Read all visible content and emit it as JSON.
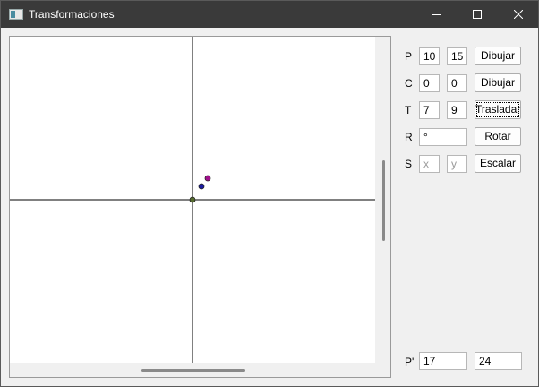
{
  "window": {
    "title": "Transformaciones"
  },
  "rows": [
    {
      "label": "P",
      "a": "10",
      "b": "15",
      "button": "Dibujar"
    },
    {
      "label": "C",
      "a": "0",
      "b": "0",
      "button": "Dibujar"
    },
    {
      "label": "T",
      "a": "7",
      "b": "9",
      "button": "Trasladar"
    },
    {
      "label": "R",
      "a": "°",
      "button": "Rotar"
    },
    {
      "label": "S",
      "a_placeholder": "x",
      "b_placeholder": "y",
      "button": "Escalar"
    }
  ],
  "result": {
    "label": "P'",
    "x": "17",
    "y": "24"
  },
  "canvas": {
    "points": [
      {
        "name": "origin",
        "x": 0,
        "y": 0,
        "color": "#556b2f"
      },
      {
        "name": "p",
        "x": 10,
        "y": 15,
        "color": "#1a1aa0"
      },
      {
        "name": "p-prime",
        "x": 17,
        "y": 24,
        "color": "#a0108c"
      }
    ]
  }
}
